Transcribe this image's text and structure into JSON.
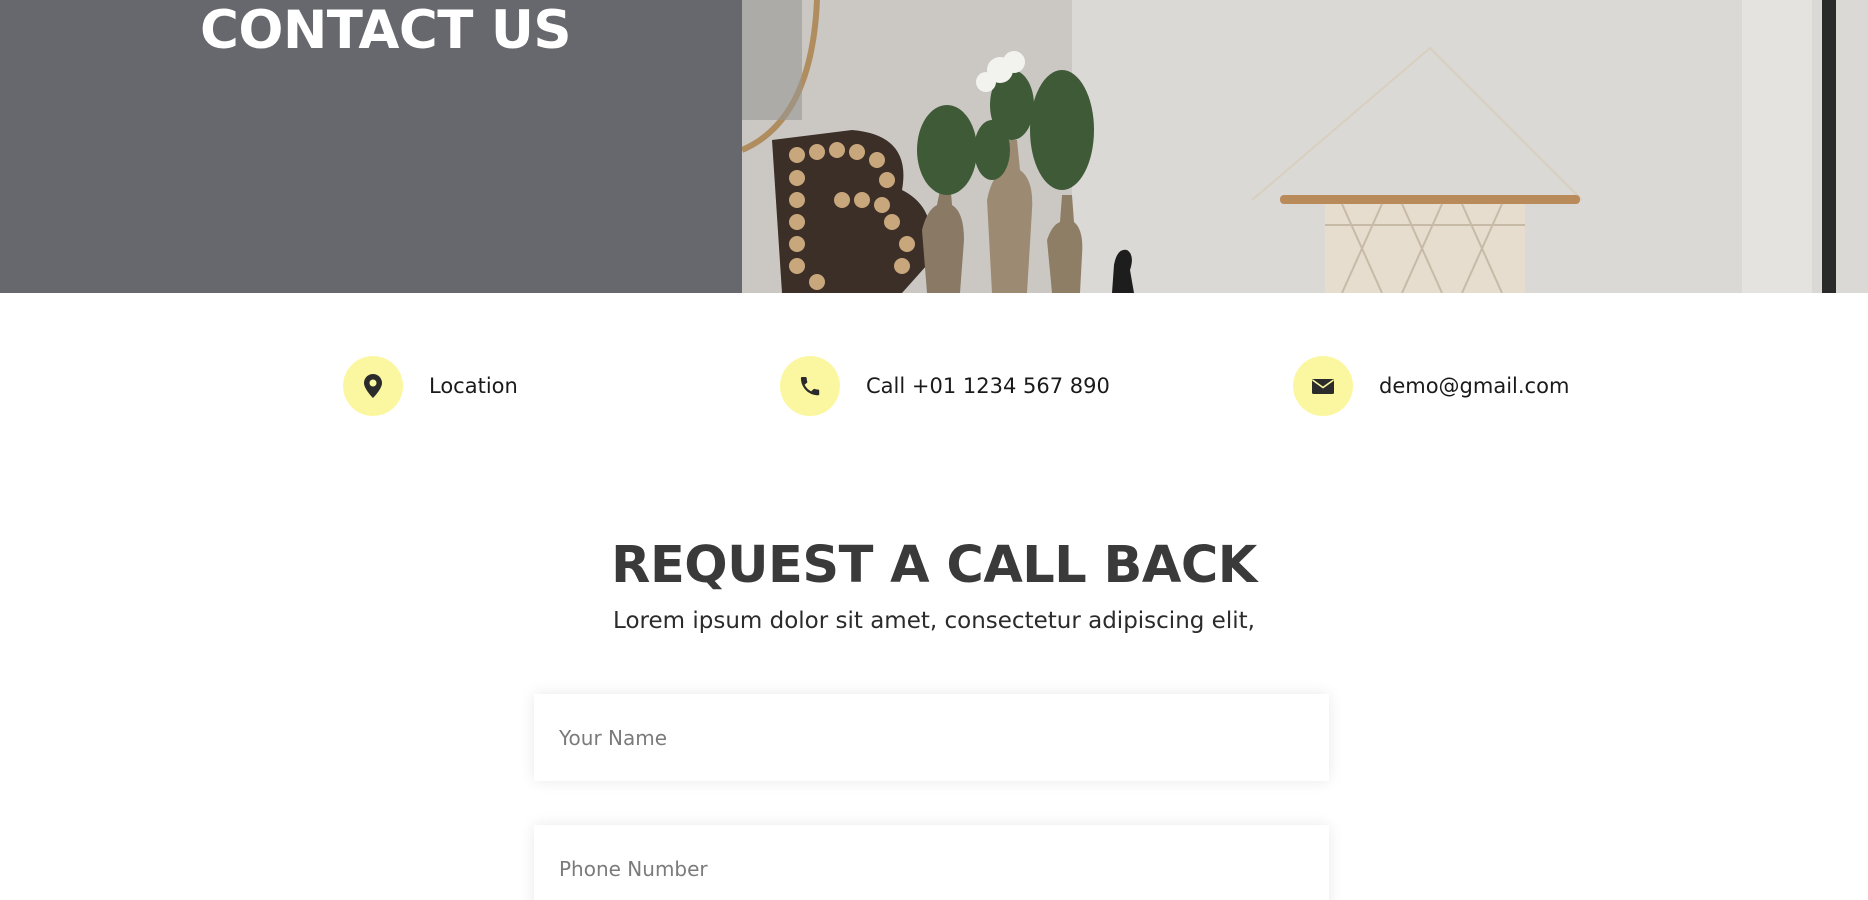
{
  "hero": {
    "title": "CONTACT US"
  },
  "contact_info": {
    "location": {
      "icon": "map-marker-icon",
      "text": "Location"
    },
    "phone": {
      "icon": "phone-icon",
      "text": "Call +01 1234 567 890"
    },
    "email": {
      "icon": "envelope-icon",
      "text": "demo@gmail.com"
    }
  },
  "callback": {
    "title": "REQUEST A CALL BACK",
    "subtitle": "Lorem ipsum dolor sit amet, consectetur adipiscing elit,",
    "name_placeholder": "Your Name",
    "phone_placeholder": "Phone Number"
  },
  "colors": {
    "hero_panel": "#67686d",
    "icon_circle": "#fbf7a0",
    "heading": "#3a3a3a"
  }
}
